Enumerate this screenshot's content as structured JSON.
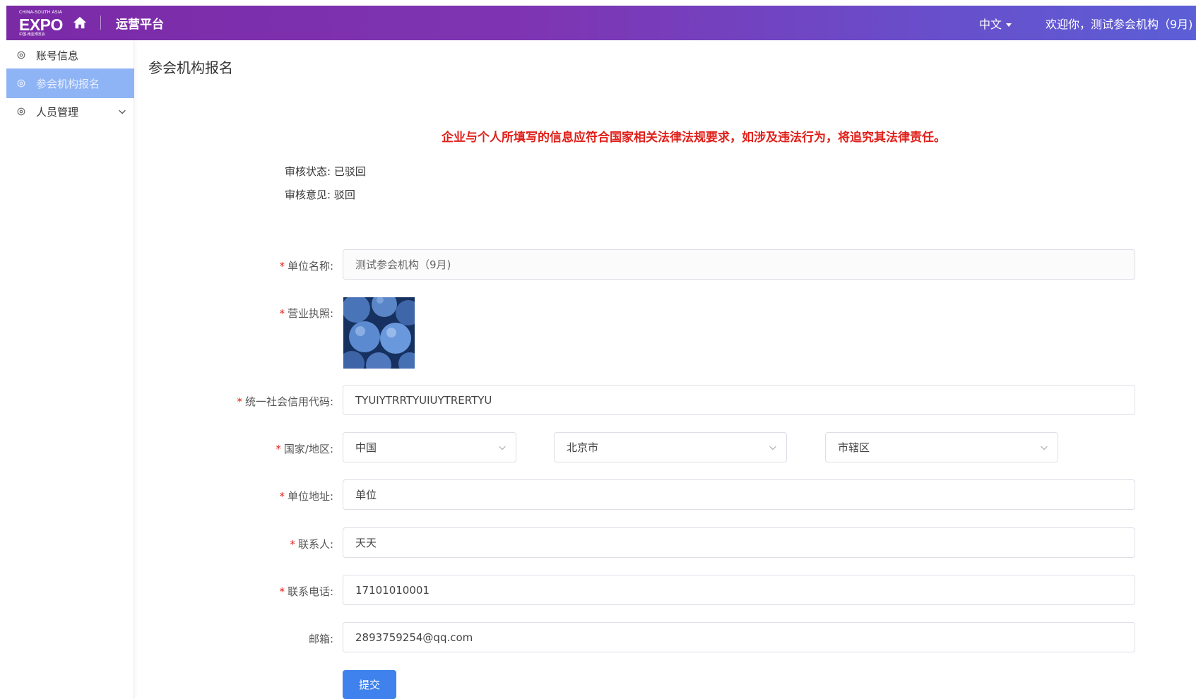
{
  "header": {
    "logo_top": "CHINA-SOUTH ASIA",
    "logo_main": "EXPO",
    "logo_bottom": "中国-南亚博览会",
    "platform_title": "运营平台",
    "language": "中文",
    "welcome": "欢迎你，测试参会机构（9月)",
    "home_icon": "home-icon"
  },
  "sidebar": {
    "items": [
      {
        "label": "账号信息",
        "icon": "gear-icon",
        "active": false
      },
      {
        "label": "参会机构报名",
        "icon": "gear-icon",
        "active": true
      },
      {
        "label": "人员管理",
        "icon": "gear-icon",
        "active": false,
        "expandable": true
      }
    ]
  },
  "main": {
    "heading": "参会机构报名",
    "warning": "企业与个人所填写的信息应符合国家相关法律法规要求，如涉及违法行为，将追究其法律责任。",
    "review_status_label": "审核状态:",
    "review_status_value": "已驳回",
    "review_comment_label": "审核意见:",
    "review_comment_value": "驳回"
  },
  "form": {
    "required_mark": "*",
    "unit_name": {
      "label": "单位名称:",
      "value": "测试参会机构（9月)"
    },
    "business_license": {
      "label": "营业执照:"
    },
    "credit_code": {
      "label": "统一社会信用代码:",
      "value": "TYUIYTRRTYUIUYTRERTYU"
    },
    "region": {
      "label": "国家/地区:",
      "country": "中国",
      "province": "北京市",
      "district": "市辖区"
    },
    "address": {
      "label": "单位地址:",
      "value": "单位"
    },
    "contact": {
      "label": "联系人:",
      "value": "天天"
    },
    "phone": {
      "label": "联系电话:",
      "value": "17101010001"
    },
    "email": {
      "label": "邮箱:",
      "value": "2893759254@qq.com"
    },
    "submit_label": "提交"
  },
  "colors": {
    "header_gradient_start": "#7b2aa6",
    "header_gradient_end": "#5c5fd6",
    "sidebar_active": "#8fb4f5",
    "warning": "#e0201a",
    "primary_button": "#3f82ee"
  }
}
